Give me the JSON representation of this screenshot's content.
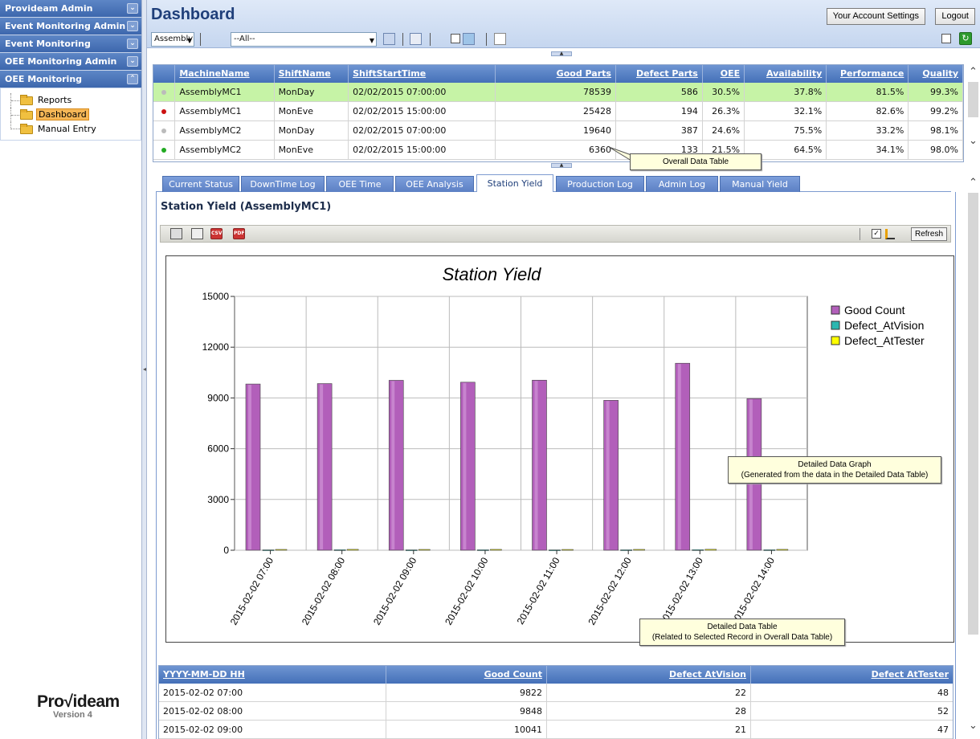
{
  "sidebar": {
    "sections": [
      {
        "label": "Provideam Admin",
        "chevron": "⌄"
      },
      {
        "label": "Event Monitoring Admin",
        "chevron": "⌄"
      },
      {
        "label": "Event Monitoring",
        "chevron": "⌄"
      },
      {
        "label": "OEE Monitoring Admin",
        "chevron": "⌄"
      },
      {
        "label": "OEE Monitoring",
        "chevron": "⌃"
      }
    ],
    "tree": [
      {
        "label": "Reports"
      },
      {
        "label": "Dashboard"
      },
      {
        "label": "Manual Entry"
      }
    ],
    "logo": {
      "text": "Pro√ideam",
      "version": "Version 4"
    }
  },
  "header": {
    "title": "Dashboard",
    "account_button": "Your Account Settings",
    "logout_button": "Logout"
  },
  "toolbar": {
    "machine_select": "Assembly",
    "filter_select": "--All--"
  },
  "overall_table": {
    "columns": [
      "MachineName",
      "ShiftName",
      "ShiftStartTime",
      "Good Parts",
      "Defect Parts",
      "OEE",
      "Availability",
      "Performance",
      "Quality"
    ],
    "rows": [
      {
        "status": "#bbbbbb",
        "cells": [
          "AssemblyMC1",
          "MonDay",
          "02/02/2015 07:00:00",
          "78539",
          "586",
          "30.5%",
          "37.8%",
          "81.5%",
          "99.3%"
        ]
      },
      {
        "status": "#cc1111",
        "cells": [
          "AssemblyMC1",
          "MonEve",
          "02/02/2015 15:00:00",
          "25428",
          "194",
          "26.3%",
          "32.1%",
          "82.6%",
          "99.2%"
        ]
      },
      {
        "status": "#bbbbbb",
        "cells": [
          "AssemblyMC2",
          "MonDay",
          "02/02/2015 07:00:00",
          "19640",
          "387",
          "24.6%",
          "75.5%",
          "33.2%",
          "98.1%"
        ]
      },
      {
        "status": "#22aa22",
        "cells": [
          "AssemblyMC2",
          "MonEve",
          "02/02/2015 15:00:00",
          "6360",
          "133",
          "21.5%",
          "64.5%",
          "34.1%",
          "98.0%"
        ]
      }
    ],
    "callout": "Overall Data Table"
  },
  "tabs": [
    "Current Status",
    "DownTime Log",
    "OEE Time",
    "OEE Analysis",
    "Station Yield",
    "Production Log",
    "Admin Log",
    "Manual Yield"
  ],
  "active_tab": "Station Yield",
  "panel": {
    "title": "Station Yield (AssemblyMC1)",
    "refresh_button": "Refresh",
    "icons": [
      "printer-icon",
      "preview-icon",
      "csv-icon",
      "pdf-icon"
    ],
    "csv_label": "CSV",
    "pdf_label": "PDF"
  },
  "chart_data": {
    "type": "bar",
    "title": "Station Yield",
    "categories": [
      "2015-02-02 07:00",
      "2015-02-02 08:00",
      "2015-02-02 09:00",
      "2015-02-02 10:00",
      "2015-02-02 11:00",
      "2015-02-02 12:00",
      "2015-02-02 13:00",
      "2015-02-02 14:00"
    ],
    "series": [
      {
        "name": "Good Count",
        "color": "#b25fba",
        "values": [
          9822,
          9848,
          10041,
          9930,
          10050,
          8860,
          11050,
          8960
        ]
      },
      {
        "name": "Defect_AtVision",
        "color": "#2bb7b0",
        "values": [
          22,
          28,
          21,
          25,
          20,
          24,
          30,
          26
        ]
      },
      {
        "name": "Defect_AtTester",
        "color": "#ffff00",
        "values": [
          48,
          52,
          47,
          50,
          45,
          49,
          55,
          51
        ]
      }
    ],
    "yticks": [
      "0",
      "3000",
      "6000",
      "9000",
      "12000",
      "15000"
    ],
    "ylim": [
      0,
      15000
    ],
    "grid": true,
    "legend": "top-right"
  },
  "callouts": {
    "graph": [
      "Detailed Data Graph",
      "(Generated from the data in the Detailed Data Table)"
    ],
    "table": [
      "Detailed Data Table",
      "(Related to Selected Record in Overall Data Table)"
    ]
  },
  "detail_table": {
    "columns": [
      "YYYY-MM-DD HH",
      "Good Count",
      "Defect AtVision",
      "Defect AtTester"
    ],
    "rows": [
      [
        "2015-02-02 07:00",
        "9822",
        "22",
        "48"
      ],
      [
        "2015-02-02 08:00",
        "9848",
        "28",
        "52"
      ],
      [
        "2015-02-02 09:00",
        "10041",
        "21",
        "47"
      ]
    ]
  }
}
